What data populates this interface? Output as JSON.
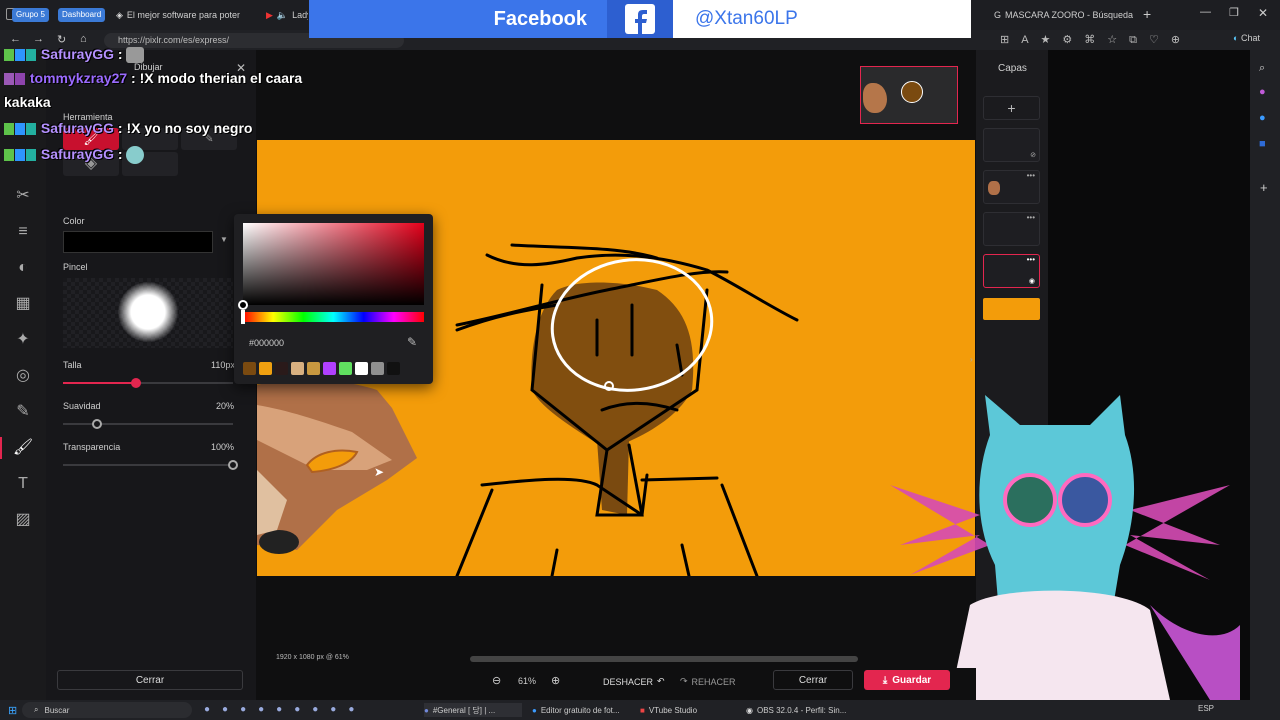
{
  "browser": {
    "tabs": [
      {
        "label": "Grupo 5"
      },
      {
        "label": "Dashboard"
      },
      {
        "label": "El mejor software para potenci"
      },
      {
        "label": "Lady"
      },
      {
        "label": "MASCARA ZOORO - Búsqueda"
      }
    ],
    "url": "https://pixlr.com/es/express/",
    "chat_label": "Chat"
  },
  "banner": {
    "network": "Facebook",
    "handle": "@Xtan60LP"
  },
  "chat": [
    {
      "user": "SafurayGG",
      "text": " :"
    },
    {
      "user": "tommykzray27",
      "text": " : !X modo therian el caara"
    },
    {
      "user": "",
      "text": "kakaka"
    },
    {
      "user": "SafurayGG",
      "text": " : !X yo no soy negro"
    },
    {
      "user": "SafurayGG",
      "text": " :"
    }
  ],
  "toolpanel": {
    "title": "Dibujar",
    "tool_label": "Herramienta",
    "color_label": "Color",
    "brush_label": "Pincel",
    "size_label": "Talla",
    "size_value": "110px",
    "size_fraction": 0.43,
    "smooth_label": "Suavidad",
    "smooth_value": "20%",
    "smooth_fraction": 0.2,
    "opacity_label": "Transparencia",
    "opacity_value": "100%",
    "opacity_fraction": 1.0,
    "close_label": "Cerrar"
  },
  "colorpicker": {
    "hex": "#000000",
    "swatches": [
      "#7a4a10",
      "#f0a010",
      "#2a1a1a",
      "#d8b080",
      "#c89840",
      "#b040ff",
      "#60e060",
      "#ffffff",
      "#909090",
      "#111111"
    ]
  },
  "layers": {
    "title": "Capas"
  },
  "bottombar": {
    "dimensions": "1920 x 1080 px @ 61%",
    "zoom": "61%",
    "undo": "DESHACER",
    "redo": "REHACER",
    "close": "Cerrar",
    "save": "Guardar"
  },
  "taskbar": {
    "search": "Buscar",
    "apps": [
      {
        "label": "#General [ 당] | ..."
      },
      {
        "label": "Editor gratuito de fot..."
      },
      {
        "label": "VTube Studio"
      },
      {
        "label": "OBS 32.0.4 - Perfil: Sin..."
      }
    ],
    "lang": "ESP"
  },
  "colors": {
    "accent": "#e3264f",
    "canvas": "#f39c0a",
    "facebook": "#3b75ea"
  }
}
